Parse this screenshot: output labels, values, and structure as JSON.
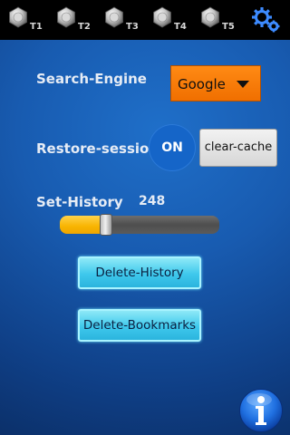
{
  "tabs": [
    {
      "label": "T1",
      "icon": "bolt-icon"
    },
    {
      "label": "T2",
      "icon": "bolt-icon"
    },
    {
      "label": "T3",
      "icon": "bolt-icon"
    },
    {
      "label": "T4",
      "icon": "bolt-icon"
    },
    {
      "label": "T5",
      "icon": "bolt-icon"
    }
  ],
  "settings": {
    "icon": "gears-icon"
  },
  "search": {
    "label": "Search-Engine",
    "selected": "Google"
  },
  "restore": {
    "label": "Restore-session",
    "toggle_state": "ON",
    "clear_label": "clear-cache"
  },
  "history": {
    "label": "Set-History",
    "value": "248",
    "slider_fraction": 0.27
  },
  "buttons": {
    "delete_history": "Delete-History",
    "delete_bookmarks": "Delete-Bookmarks"
  },
  "info": {
    "icon": "info-icon"
  },
  "colors": {
    "accent_orange": "#f27300",
    "button_cyan": "#3ec8ec",
    "slider_fill": "#f8b400"
  }
}
